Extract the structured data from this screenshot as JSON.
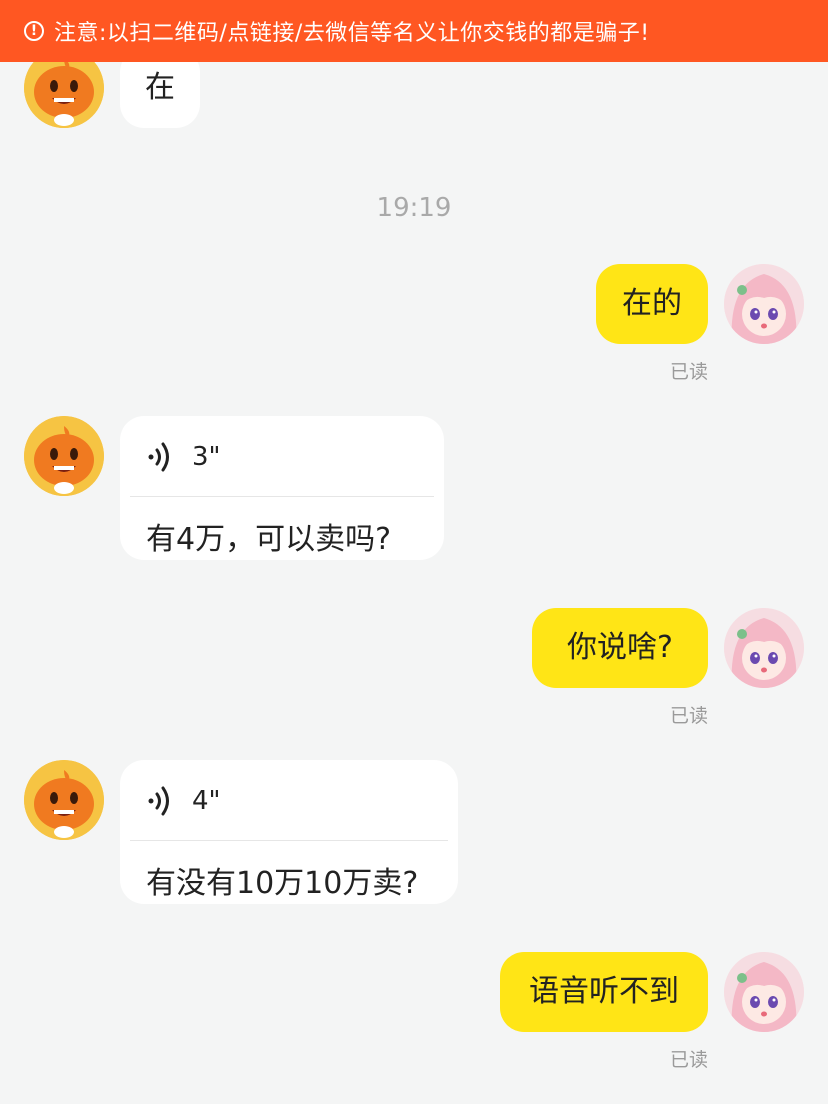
{
  "banner": {
    "icon": "warning-circle-icon",
    "text": "注意:以扫二维码/点链接/去微信等名义让你交钱的都是骗子!",
    "bg_color": "#ff5722"
  },
  "colors": {
    "my_bubble": "#ffe516",
    "their_bubble": "#ffffff",
    "background": "#f4f5f5"
  },
  "messages": {
    "m1": {
      "text": "在"
    },
    "timestamp": "19:19",
    "m2": {
      "text": "在的",
      "status": "已读"
    },
    "m3": {
      "duration": "3\"",
      "transcript": "有4万，可以卖吗?"
    },
    "m4": {
      "text": "你说啥?",
      "status": "已读"
    },
    "m5": {
      "duration": "4\"",
      "transcript": "有没有10万10万卖?"
    },
    "m6": {
      "text": "语音听不到",
      "status": "已读"
    }
  }
}
